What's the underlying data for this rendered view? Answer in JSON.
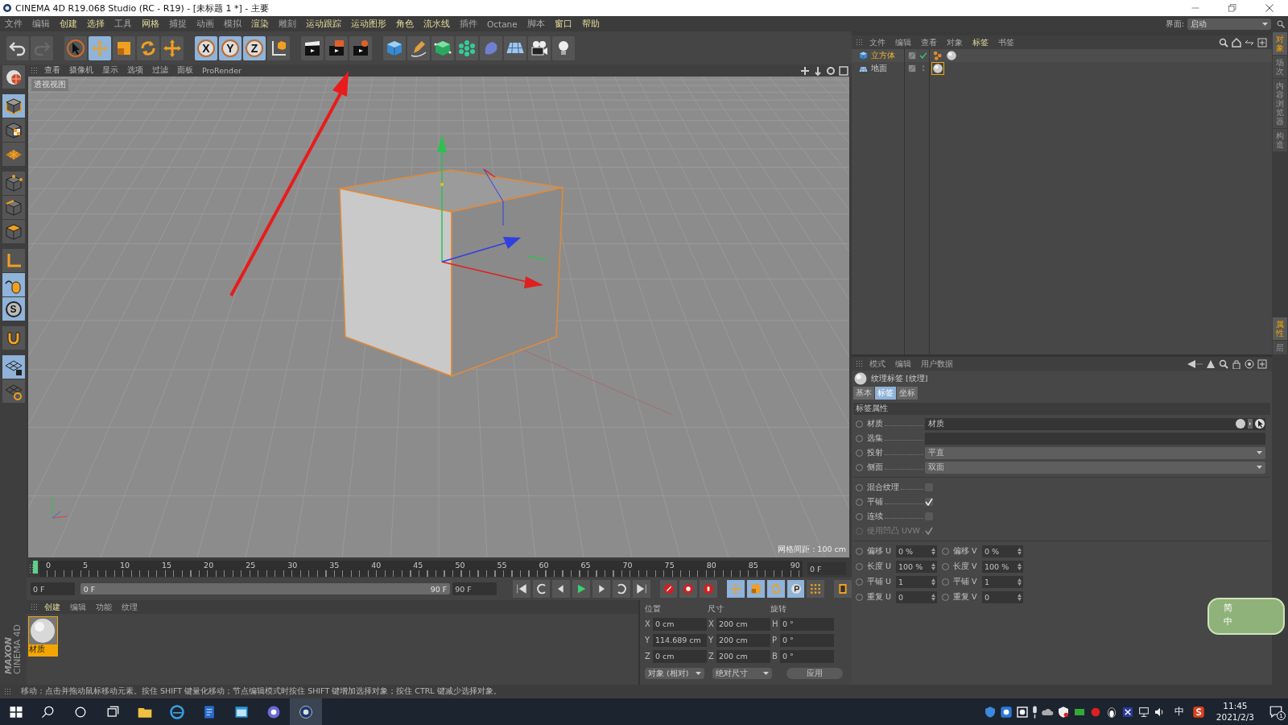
{
  "window": {
    "title": "CINEMA 4D R19.068 Studio (RC - R19) - [未标题 1 *] - 主要"
  },
  "menu_bar": {
    "items": [
      {
        "label": "文件",
        "emphasized": false
      },
      {
        "label": "编辑",
        "emphasized": false
      },
      {
        "label": "创建",
        "emphasized": true
      },
      {
        "label": "选择",
        "emphasized": true
      },
      {
        "label": "工具",
        "emphasized": false
      },
      {
        "label": "网格",
        "emphasized": true
      },
      {
        "label": "捕捉",
        "emphasized": false
      },
      {
        "label": "动画",
        "emphasized": false
      },
      {
        "label": "模拟",
        "emphasized": false
      },
      {
        "label": "渲染",
        "emphasized": true
      },
      {
        "label": "雕刻",
        "emphasized": false
      },
      {
        "label": "运动跟踪",
        "emphasized": true
      },
      {
        "label": "运动图形",
        "emphasized": true
      },
      {
        "label": "角色",
        "emphasized": true
      },
      {
        "label": "流水线",
        "emphasized": true
      },
      {
        "label": "插件",
        "emphasized": false
      },
      {
        "label": "Octane",
        "emphasized": false
      },
      {
        "label": "脚本",
        "emphasized": false
      },
      {
        "label": "窗口",
        "emphasized": true
      },
      {
        "label": "帮助",
        "emphasized": true
      }
    ],
    "layout_label": "界面:",
    "layout_value": "启动"
  },
  "toolbar": [
    {
      "kind": "undo",
      "selected": false
    },
    {
      "kind": "redo",
      "selected": false
    },
    {
      "kind": "select",
      "selected": false
    },
    {
      "kind": "move",
      "selected": true
    },
    {
      "kind": "scale",
      "selected": false
    },
    {
      "kind": "rotate",
      "selected": false
    },
    {
      "kind": "transform",
      "selected": false
    },
    {
      "kind": "axis",
      "label": "X",
      "selected": true
    },
    {
      "kind": "axis",
      "label": "Y",
      "selected": true
    },
    {
      "kind": "axis",
      "label": "Z",
      "selected": true
    },
    {
      "kind": "coord",
      "selected": false
    },
    {
      "kind": "render-view",
      "selected": false
    },
    {
      "kind": "render-picture",
      "selected": false
    },
    {
      "kind": "render-settings",
      "selected": false
    },
    {
      "kind": "cube",
      "selected": false
    },
    {
      "kind": "pen",
      "selected": false
    },
    {
      "kind": "subdivide",
      "selected": false
    },
    {
      "kind": "cloner",
      "selected": false
    },
    {
      "kind": "deformer",
      "selected": false
    },
    {
      "kind": "floor",
      "selected": false
    },
    {
      "kind": "camera",
      "selected": false
    },
    {
      "kind": "light",
      "selected": false
    }
  ],
  "left_tools": [
    {
      "kind": "sphere",
      "selected": false
    },
    {
      "kind": "model",
      "selected": true
    },
    {
      "kind": "texture",
      "selected": false
    },
    {
      "kind": "workplane",
      "selected": false
    },
    {
      "kind": "points",
      "selected": false
    },
    {
      "kind": "edges",
      "selected": false
    },
    {
      "kind": "polygons",
      "selected": false
    },
    {
      "kind": "axis",
      "selected": false
    },
    {
      "kind": "tweak",
      "selected": true
    },
    {
      "kind": "solo",
      "label": "S",
      "selected": true
    },
    {
      "kind": "snap",
      "selected": false
    },
    {
      "kind": "grid-lock",
      "selected": true
    },
    {
      "kind": "grid-cycle",
      "selected": false
    }
  ],
  "viewport": {
    "menu": [
      "查看",
      "摄像机",
      "显示",
      "选项",
      "过滤",
      "面板",
      "ProRender"
    ],
    "label": "透视视图",
    "grid_info": "网格间距 : 100 cm"
  },
  "timeline": {
    "ticks": [
      "0",
      "5",
      "10",
      "15",
      "20",
      "25",
      "30",
      "35",
      "40",
      "45",
      "50",
      "55",
      "60",
      "65",
      "70",
      "75",
      "80",
      "85",
      "90"
    ],
    "current_frame": "0 F",
    "start_field": "0 F",
    "range_start": "0 F",
    "range_end": "90 F",
    "level": 1,
    "end_field": "90 F"
  },
  "logo": {
    "brand": "MAXON",
    "product": "CINEMA 4D"
  },
  "material_manager": {
    "menu": [
      {
        "label": "创建",
        "selected": true
      },
      {
        "label": "编辑",
        "selected": false
      },
      {
        "label": "功能",
        "selected": false
      },
      {
        "label": "纹理",
        "selected": false
      }
    ],
    "materials": [
      {
        "name": "材质",
        "selected": true
      }
    ]
  },
  "coordinates": {
    "headers": [
      "位置",
      "尺寸",
      "旋转"
    ],
    "rows": [
      {
        "axes": [
          "X",
          "X",
          "H"
        ],
        "values": [
          "0 cm",
          "200 cm",
          "0 °"
        ]
      },
      {
        "axes": [
          "Y",
          "Y",
          "P"
        ],
        "values": [
          "114.689 cm",
          "200 cm",
          "0 °"
        ]
      },
      {
        "axes": [
          "Z",
          "Z",
          "B"
        ],
        "values": [
          "0 cm",
          "200 cm",
          "0 °"
        ]
      }
    ],
    "mode": "对象 (相对)",
    "size_mode": "绝对尺寸",
    "apply": "应用"
  },
  "object_manager": {
    "menu": [
      {
        "label": "文件",
        "selected": false
      },
      {
        "label": "编辑",
        "selected": false
      },
      {
        "label": "查看",
        "selected": false
      },
      {
        "label": "对象",
        "selected": false
      },
      {
        "label": "标签",
        "selected": true
      },
      {
        "label": "书签",
        "selected": false
      }
    ],
    "objects": [
      {
        "name": "立方体",
        "kind": "cube",
        "selected": true,
        "checked": true,
        "tags": [
          {
            "kind": "phong",
            "selected": false
          },
          {
            "kind": "material",
            "selected": false
          }
        ]
      },
      {
        "name": "地面",
        "kind": "floor",
        "selected": false,
        "checked": false,
        "tags": [
          {
            "kind": "material",
            "selected": true
          }
        ]
      }
    ]
  },
  "attributes": {
    "menu": [
      "模式",
      "编辑",
      "用户数据"
    ],
    "title": "纹理标签 [纹理]",
    "tabs": [
      {
        "label": "基本",
        "selected": false
      },
      {
        "label": "标签",
        "selected": true
      },
      {
        "label": "坐标",
        "selected": false
      }
    ],
    "section": "标签属性",
    "fields": [
      {
        "kind": "link",
        "label": "材质",
        "value": "材质"
      },
      {
        "kind": "text",
        "label": "选集"
      },
      {
        "kind": "dropdown",
        "label": "投射",
        "value": "平直"
      },
      {
        "kind": "dropdown",
        "label": "侧面",
        "value": "双面"
      }
    ],
    "options": [
      {
        "label": "混合纹理",
        "checked": false,
        "disabled": false
      },
      {
        "label": "平铺",
        "checked": true,
        "disabled": false
      },
      {
        "label": "连续",
        "checked": false,
        "disabled": false
      },
      {
        "label": "使用凹凸 UVW",
        "checked": true,
        "disabled": true
      }
    ],
    "pairs": [
      {
        "label_u": "偏移 U",
        "value_u": "0 %",
        "label_v": "偏移 V",
        "value_v": "0 %"
      },
      {
        "label_u": "长度 U",
        "value_u": "100 %",
        "label_v": "长度 V",
        "value_v": "100 %"
      },
      {
        "label_u": "平铺 U",
        "value_u": "1",
        "label_v": "平铺 V",
        "value_v": "1"
      },
      {
        "label_u": "重复 U",
        "value_u": "0",
        "label_v": "重复 V",
        "value_v": "0"
      }
    ]
  },
  "side_tabs": {
    "top": [
      {
        "label": "对象",
        "selected": true
      },
      {
        "label": "场次",
        "selected": false
      },
      {
        "label": "内容浏览器",
        "selected": false
      },
      {
        "label": "构造",
        "selected": false
      }
    ],
    "bottom": [
      {
        "label": "属性",
        "selected": true
      },
      {
        "label": "层",
        "selected": false
      }
    ]
  },
  "status_bar": {
    "text": "移动：点击并拖动鼠标移动元素。按住 SHIFT 键量化移动；节点编辑模式时按住 SHIFT 键增加选择对象；按住 CTRL 键减少选择对象。"
  },
  "ime_widget": {
    "mode": "简",
    "language": "中"
  },
  "taskbar": {
    "apps": [
      {
        "kind": "explorer",
        "selected": false
      },
      {
        "kind": "browser",
        "selected": false
      },
      {
        "kind": "document",
        "selected": false
      },
      {
        "kind": "window",
        "selected": false
      },
      {
        "kind": "flower",
        "selected": false
      },
      {
        "kind": "cinema",
        "selected": true
      }
    ],
    "input_language": "中",
    "time": "11:45",
    "date": "2021/2/3",
    "notifications": "1"
  }
}
